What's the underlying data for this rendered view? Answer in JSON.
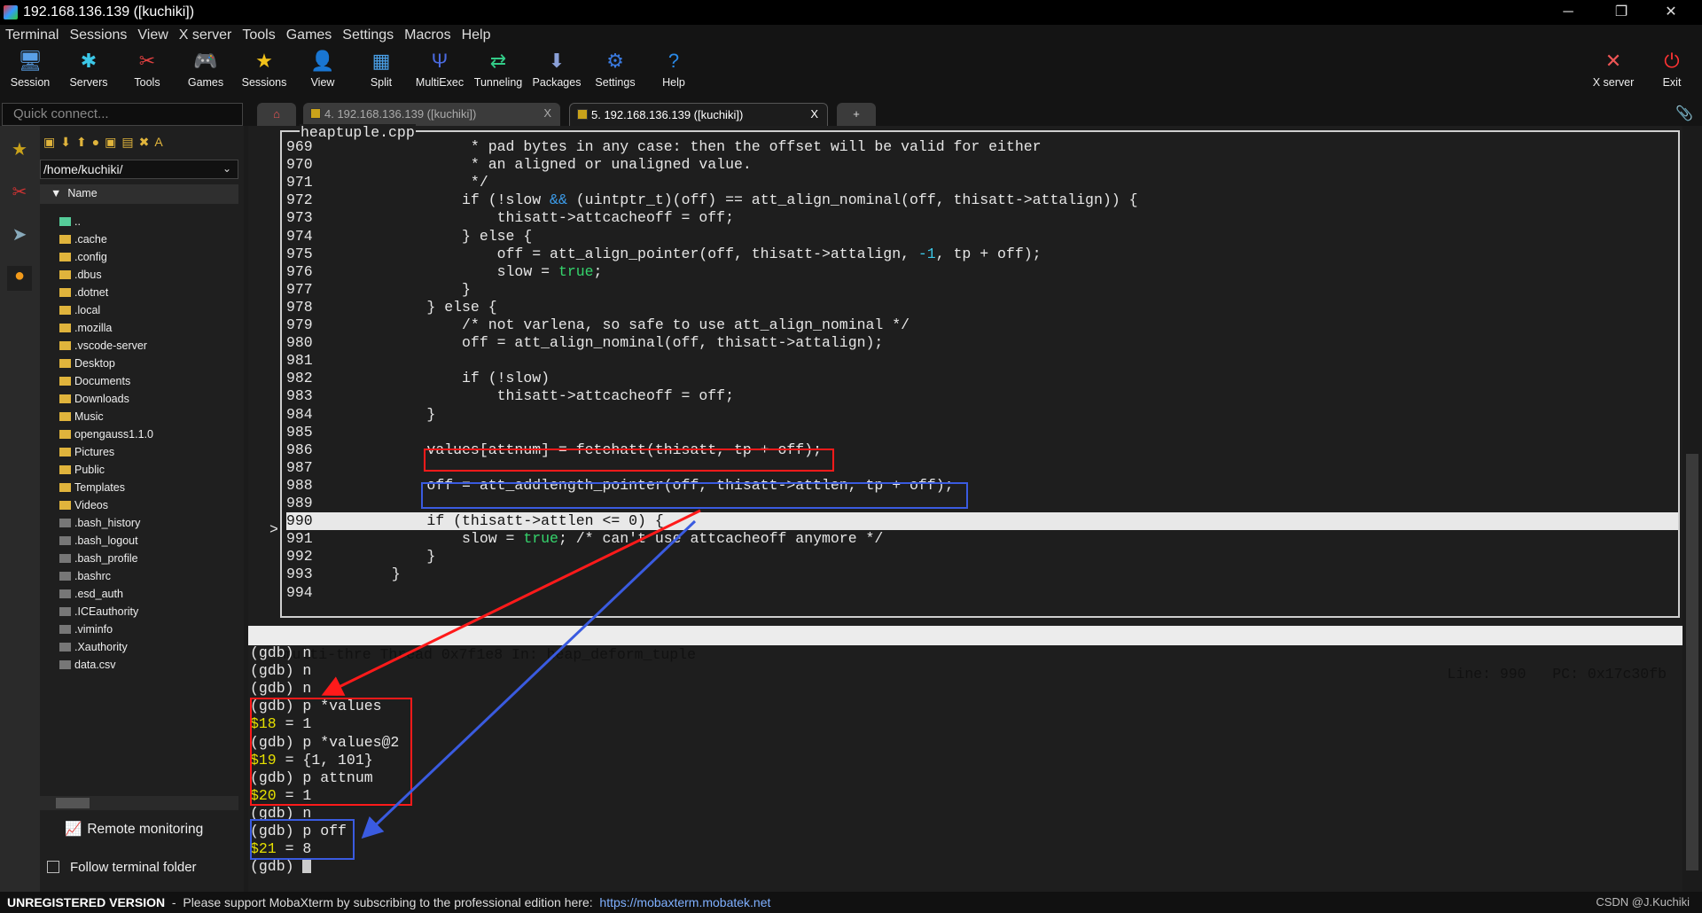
{
  "window": {
    "title": "192.168.136.139 ([kuchiki])",
    "minimize": "─",
    "maximize": "❐",
    "close": "✕"
  },
  "menu": [
    "Terminal",
    "Sessions",
    "View",
    "X server",
    "Tools",
    "Games",
    "Settings",
    "Macros",
    "Help"
  ],
  "toolbar": [
    {
      "label": "Session",
      "icon": "session-icon",
      "glyph": "🖥"
    },
    {
      "label": "Servers",
      "icon": "servers-icon",
      "glyph": "✱"
    },
    {
      "label": "Tools",
      "icon": "tools-icon",
      "glyph": "✂"
    },
    {
      "label": "Games",
      "icon": "games-icon",
      "glyph": "🎮"
    },
    {
      "label": "Sessions",
      "icon": "star-icon",
      "glyph": "★"
    },
    {
      "label": "View",
      "icon": "view-icon",
      "glyph": "👤"
    },
    {
      "label": "Split",
      "icon": "split-icon",
      "glyph": "▦"
    },
    {
      "label": "MultiExec",
      "icon": "multiexec-icon",
      "glyph": "Ψ"
    },
    {
      "label": "Tunneling",
      "icon": "tunneling-icon",
      "glyph": "⇄"
    },
    {
      "label": "Packages",
      "icon": "packages-icon",
      "glyph": "⬇"
    },
    {
      "label": "Settings",
      "icon": "settings-icon",
      "glyph": "⚙"
    },
    {
      "label": "Help",
      "icon": "help-icon",
      "glyph": "?"
    }
  ],
  "toolbar_right": [
    {
      "label": "X server",
      "icon": "xserver-icon",
      "glyph": "✕"
    },
    {
      "label": "Exit",
      "icon": "power-icon",
      "glyph": "⏻"
    }
  ],
  "quick_connect": {
    "placeholder": "Quick connect..."
  },
  "tabs": [
    {
      "label": "4. 192.168.136.139 ([kuchiki])",
      "close": "X"
    },
    {
      "label": "5. 192.168.136.139 ([kuchiki])",
      "close": "X",
      "active": true
    }
  ],
  "new_tab": "+",
  "sidebar": {
    "path": "/home/kuchiki/",
    "column": "Name",
    "files": [
      {
        "name": "..",
        "type": "up"
      },
      {
        "name": ".cache",
        "type": "folder"
      },
      {
        "name": ".config",
        "type": "folder"
      },
      {
        "name": ".dbus",
        "type": "folder"
      },
      {
        "name": ".dotnet",
        "type": "folder"
      },
      {
        "name": ".local",
        "type": "folder"
      },
      {
        "name": ".mozilla",
        "type": "folder"
      },
      {
        "name": ".vscode-server",
        "type": "folder"
      },
      {
        "name": "Desktop",
        "type": "folder"
      },
      {
        "name": "Documents",
        "type": "folder"
      },
      {
        "name": "Downloads",
        "type": "folder"
      },
      {
        "name": "Music",
        "type": "folder"
      },
      {
        "name": "opengauss1.1.0",
        "type": "folder"
      },
      {
        "name": "Pictures",
        "type": "folder"
      },
      {
        "name": "Public",
        "type": "folder"
      },
      {
        "name": "Templates",
        "type": "folder"
      },
      {
        "name": "Videos",
        "type": "folder"
      },
      {
        "name": ".bash_history",
        "type": "file"
      },
      {
        "name": ".bash_logout",
        "type": "file"
      },
      {
        "name": ".bash_profile",
        "type": "file"
      },
      {
        "name": ".bashrc",
        "type": "file"
      },
      {
        "name": ".esd_auth",
        "type": "file"
      },
      {
        "name": ".ICEauthority",
        "type": "file"
      },
      {
        "name": ".viminfo",
        "type": "file"
      },
      {
        "name": ".Xauthority",
        "type": "file"
      },
      {
        "name": "data.csv",
        "type": "file"
      }
    ],
    "remote_monitoring": "Remote monitoring",
    "follow_folder": "Follow terminal folder"
  },
  "source": {
    "filename": "heaptuple.cpp",
    "current_line": "990",
    "marker": ">",
    "lines": [
      [
        "969",
        "                 * pad bytes in any case: then the offset will be valid for either"
      ],
      [
        "970",
        "                 * an aligned or unaligned value."
      ],
      [
        "971",
        "                 */"
      ],
      [
        "972",
        "                if (!slow && (uintptr_t)(off) == att_align_nominal(off, thisatt->attalign)) {"
      ],
      [
        "973",
        "                    thisatt->attcacheoff = off;"
      ],
      [
        "974",
        "                } else {"
      ],
      [
        "975",
        "                    off = att_align_pointer(off, thisatt->attalign, -1, tp + off);"
      ],
      [
        "976",
        "                    slow = true;"
      ],
      [
        "977",
        "                }"
      ],
      [
        "978",
        "            } else {"
      ],
      [
        "979",
        "                /* not varlena, so safe to use att_align_nominal */"
      ],
      [
        "980",
        "                off = att_align_nominal(off, thisatt->attalign);"
      ],
      [
        "981",
        ""
      ],
      [
        "982",
        "                if (!slow)"
      ],
      [
        "983",
        "                    thisatt->attcacheoff = off;"
      ],
      [
        "984",
        "            }"
      ],
      [
        "985",
        ""
      ],
      [
        "986",
        "            values[attnum] = fetchatt(thisatt, tp + off);"
      ],
      [
        "987",
        ""
      ],
      [
        "988",
        "            off = att_addlength_pointer(off, thisatt->attlen, tp + off);"
      ],
      [
        "989",
        ""
      ],
      [
        "990",
        "            if (thisatt->attlen <= 0) {"
      ],
      [
        "991",
        "                slow = true; /* can't use attcacheoff anymore */"
      ],
      [
        "992",
        "            }"
      ],
      [
        "993",
        "        }"
      ],
      [
        "994",
        ""
      ]
    ]
  },
  "gdb_status": {
    "left": "multi-thre Thread 0x7f1e8 In: heap_deform_tuple",
    "right": "Line: 990   PC: 0x17c30fb"
  },
  "gdb": [
    {
      "prompt": "(gdb) ",
      "cmd": "n"
    },
    {
      "prompt": "(gdb) ",
      "cmd": "n"
    },
    {
      "prompt": "(gdb) ",
      "cmd": "n"
    },
    {
      "prompt": "(gdb) ",
      "cmd": "p *values"
    },
    {
      "var": "$18",
      "val": " = 1"
    },
    {
      "prompt": "(gdb) ",
      "cmd": "p *values@2"
    },
    {
      "var": "$19",
      "val": " = {1, 101}"
    },
    {
      "prompt": "(gdb) ",
      "cmd": "p attnum"
    },
    {
      "var": "$20",
      "val": " = 1"
    },
    {
      "prompt": "(gdb) ",
      "cmd": "n"
    },
    {
      "prompt": "(gdb) ",
      "cmd": "p off"
    },
    {
      "var": "$21",
      "val": " = 8"
    },
    {
      "prompt": "(gdb) ",
      "cmd": "",
      "cursor": true
    }
  ],
  "annotations": {
    "red": "#ff1a1a",
    "blue": "#3a5be0"
  },
  "statusbar": {
    "unregistered": "UNREGISTERED VERSION",
    "message": "  -  Please support MobaXterm by subscribing to the professional edition here:  ",
    "link": "https://mobaxterm.mobatek.net",
    "watermark": "CSDN @J.Kuchiki"
  }
}
